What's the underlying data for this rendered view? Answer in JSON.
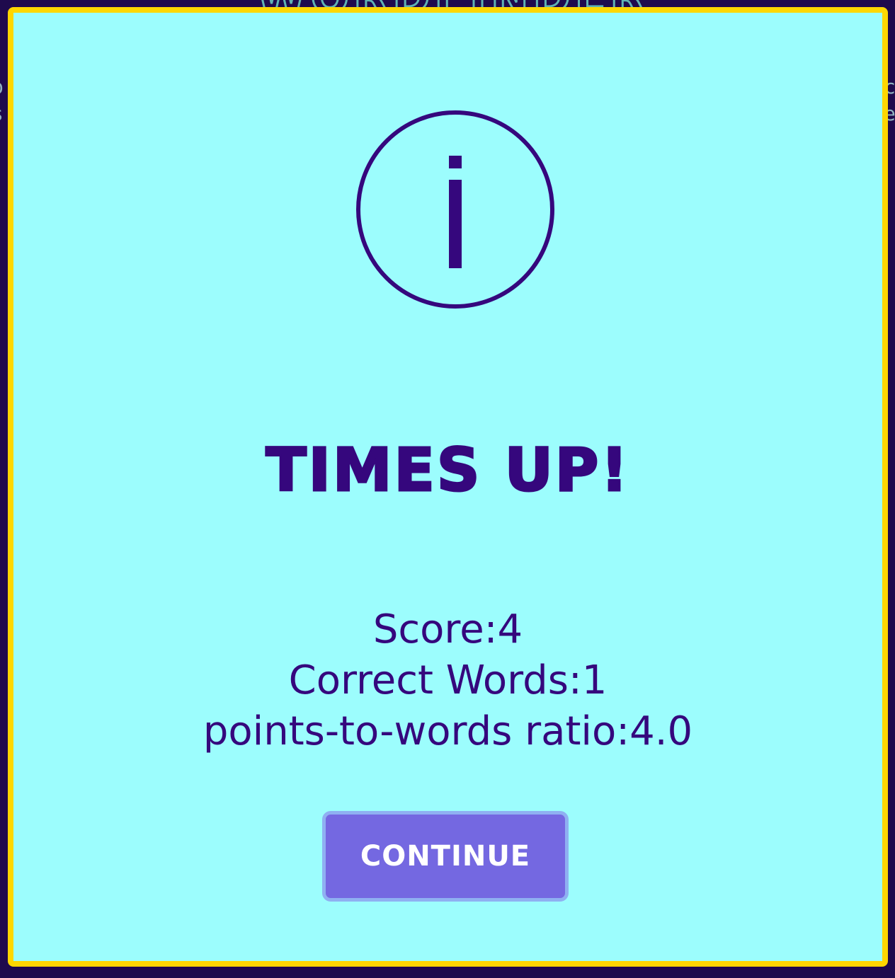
{
  "background": {
    "title_fragment": "WORDFINDER",
    "left_edge": [
      "p",
      "s"
    ],
    "right_edge": [
      "c",
      "e"
    ]
  },
  "modal": {
    "icon": "info-icon",
    "title": "TIMES UP!",
    "stats": [
      "Score:4",
      "Correct Words:1",
      "points-to-words ratio:4.0"
    ],
    "continue_label": "CONTINUE"
  },
  "colors": {
    "page_bg": "#1f0a4d",
    "modal_bg": "#9cfdfd",
    "modal_border": "#ffd700",
    "text": "#35077d",
    "button_bg": "#7468e1",
    "button_border": "#8fb0f2",
    "button_text": "#ffffff"
  }
}
